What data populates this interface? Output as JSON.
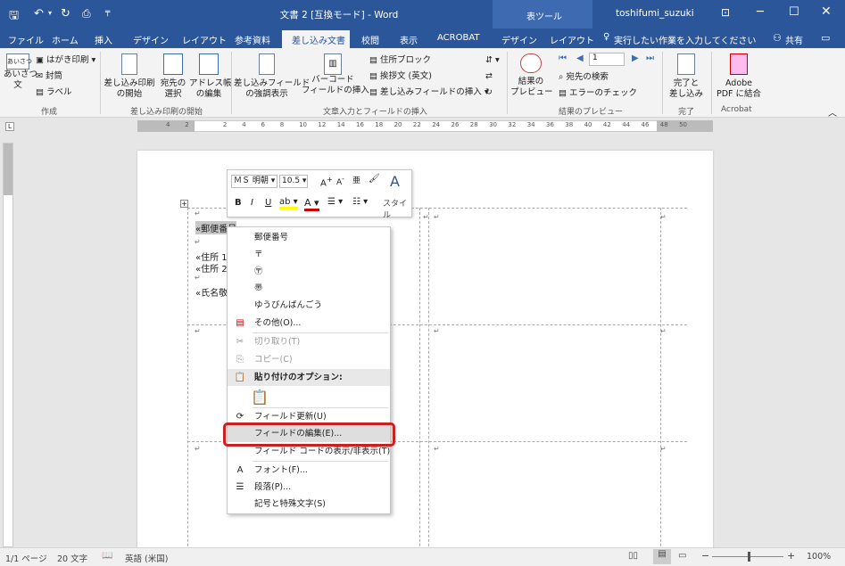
{
  "titlebar": {
    "title": "文書 2 [互換モード] - Word",
    "context_tools": "表ツール",
    "user": "toshifumi_suzuki"
  },
  "tabs": [
    "ファイル",
    "ホーム",
    "挿入",
    "デザイン",
    "レイアウト",
    "参考資料",
    "差し込み文書",
    "校閲",
    "表示",
    "ACROBAT",
    "デザイン",
    "レイアウト"
  ],
  "tell_me": "実行したい作業を入力してください",
  "share": "共有",
  "ribbon": {
    "create": {
      "label": "作成",
      "greeting": "あいさつ\n文",
      "postcard": "はがき印刷",
      "envelope": "封筒",
      "labels": "ラベル"
    },
    "start": {
      "label": "差し込み印刷の開始",
      "start_btn": "差し込み印刷\nの開始",
      "select_btn": "宛先の\n選択",
      "edit_btn": "アドレス帳\nの編集"
    },
    "write": {
      "label": "文章入力とフィールドの挿入",
      "highlight_btn": "差し込みフィールド\nの強調表示",
      "barcode_btn": "バーコード\nフィールドの挿入",
      "address_block": "住所ブロック",
      "greeting_line": "挨拶文 (英文)",
      "insert_field": "差し込みフィールドの挿入"
    },
    "preview": {
      "label": "結果のプレビュー",
      "preview_btn": "結果の\nプレビュー",
      "record": "1",
      "find": "宛先の検索",
      "check": "エラーのチェック"
    },
    "finish": {
      "label": "完了",
      "finish_btn": "完了と\n差し込み"
    },
    "acrobat": {
      "label": "Acrobat",
      "pdf_btn": "Adobe\nPDF に結合"
    }
  },
  "ruler_numbers": [
    "4",
    "2",
    "",
    "2",
    "4",
    "6",
    "8",
    "10",
    "12",
    "14",
    "16",
    "18",
    "20",
    "22",
    "24",
    "26",
    "28",
    "30",
    "32",
    "34",
    "36",
    "38",
    "40",
    "42",
    "44",
    "46",
    "48",
    "50"
  ],
  "document": {
    "field1": "«郵便番号",
    "line2": "«住所 1",
    "line3": "«住所 2",
    "line4": "«氏名敬"
  },
  "mini_toolbar": {
    "font": "ＭＳ 明朝",
    "size": "10.5",
    "style": "スタイル"
  },
  "context_menu": {
    "items": [
      {
        "label": "郵便番号",
        "icon": "",
        "disabled": false
      },
      {
        "label": "〒",
        "icon": "",
        "disabled": false
      },
      {
        "label": "〶",
        "icon": "",
        "disabled": false
      },
      {
        "label": "〠",
        "icon": "",
        "disabled": false
      },
      {
        "label": "ゆうびんばんごう",
        "icon": "",
        "disabled": false
      },
      {
        "label": "その他(O)...",
        "icon": "clipboard-icon",
        "disabled": false
      },
      {
        "label": "切り取り(T)",
        "icon": "scissors-icon",
        "disabled": true
      },
      {
        "label": "コピー(C)",
        "icon": "copy-icon",
        "disabled": true
      }
    ],
    "paste_header": "貼り付けのオプション:",
    "items2": [
      {
        "label": "フィールド更新(U)",
        "icon": "refresh-icon"
      },
      {
        "label": "フィールドの編集(E)...",
        "icon": ""
      },
      {
        "label": "フィールド コードの表示/非表示(T)",
        "icon": ""
      },
      {
        "label": "フォント(F)...",
        "icon": "font-icon"
      },
      {
        "label": "段落(P)...",
        "icon": "paragraph-icon"
      },
      {
        "label": "記号と特殊文字(S)",
        "icon": ""
      }
    ]
  },
  "status": {
    "page": "1/1 ページ",
    "words": "20 文字",
    "lang": "英語 (米国)",
    "zoom": "100%"
  },
  "colors": {
    "word_blue": "#2b579a",
    "highlight": "#cc1f1f"
  }
}
